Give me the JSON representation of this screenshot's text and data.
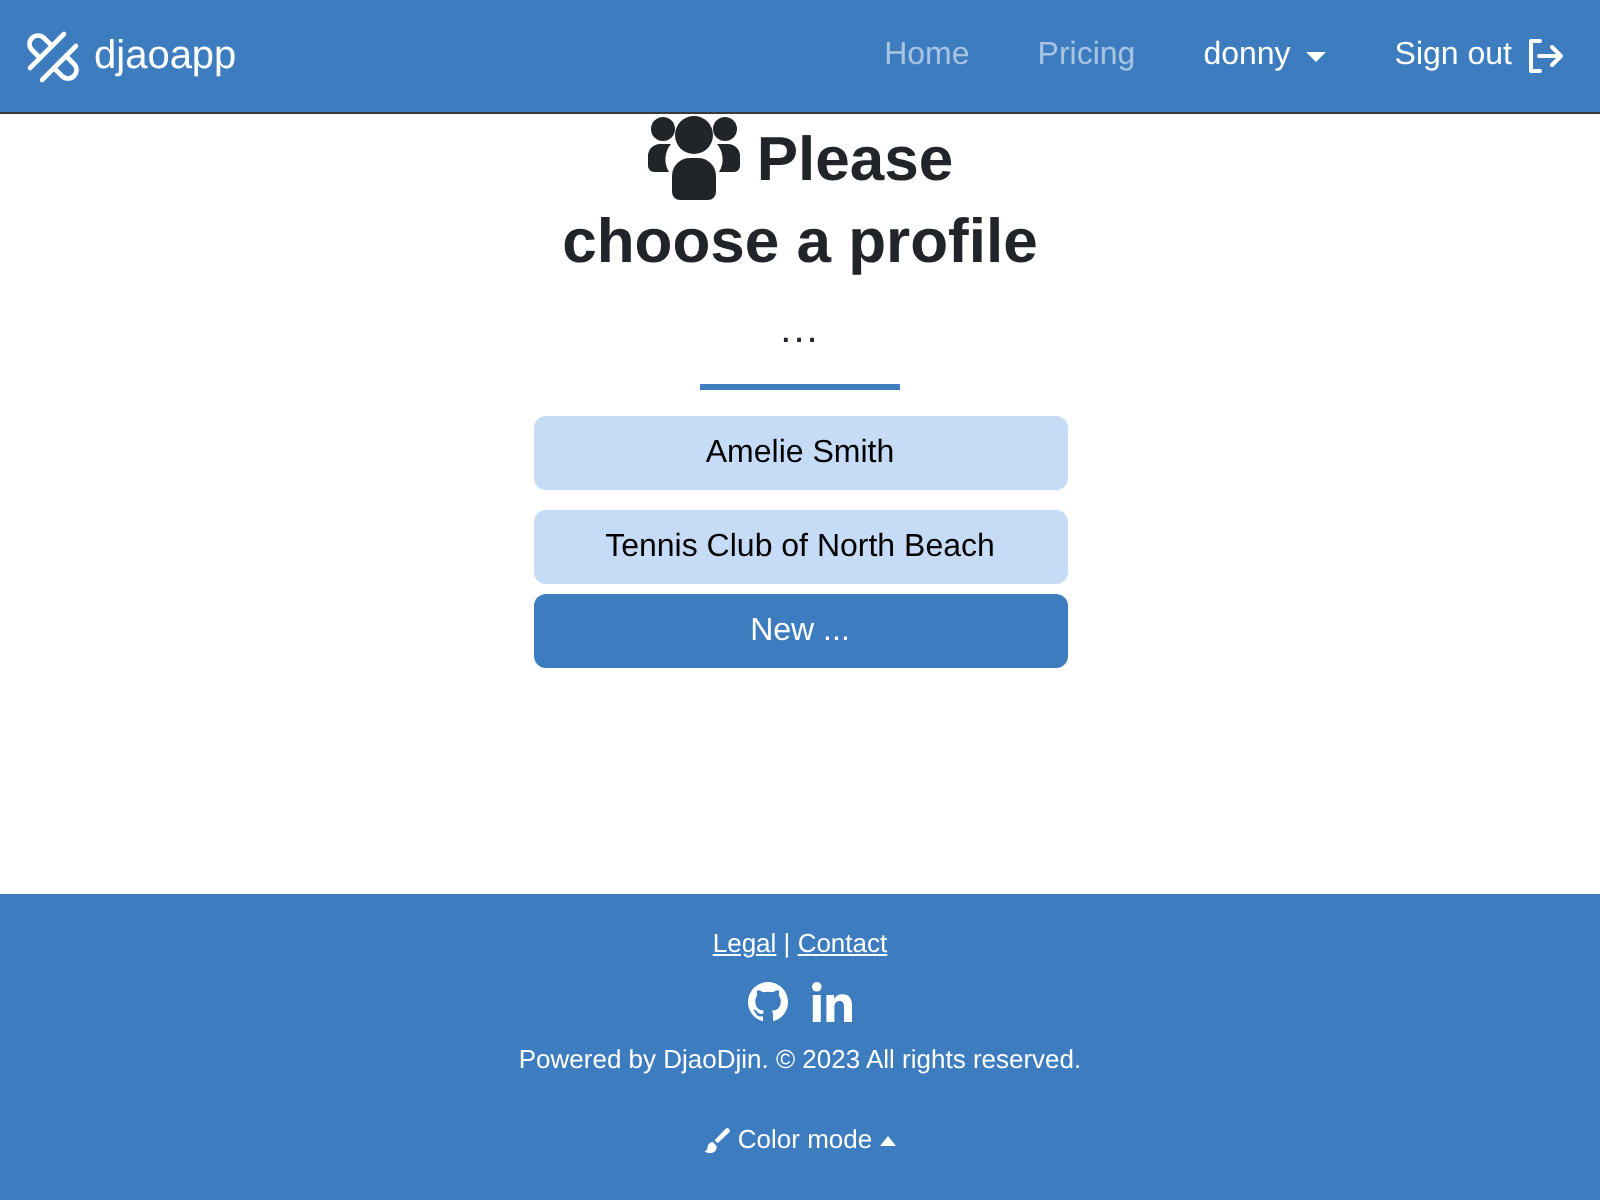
{
  "navbar": {
    "brand": "djaoapp",
    "links": [
      "Home",
      "Pricing"
    ],
    "user_menu": "donny",
    "sign_out": "Sign out"
  },
  "main": {
    "title_lines": [
      "Please",
      "choose a profile"
    ],
    "status": "...",
    "profiles": [
      {
        "label": "Amelie Smith",
        "kind": "profile"
      },
      {
        "label": "Tennis Club of North Beach",
        "kind": "profile"
      },
      {
        "label": "New ...",
        "kind": "new"
      }
    ]
  },
  "footer": {
    "links": [
      "Legal",
      "Contact"
    ],
    "separator": "|",
    "copyright": "Powered by DjaoDjin. © 2023 All rights reserved.",
    "color_mode": "Color mode"
  }
}
